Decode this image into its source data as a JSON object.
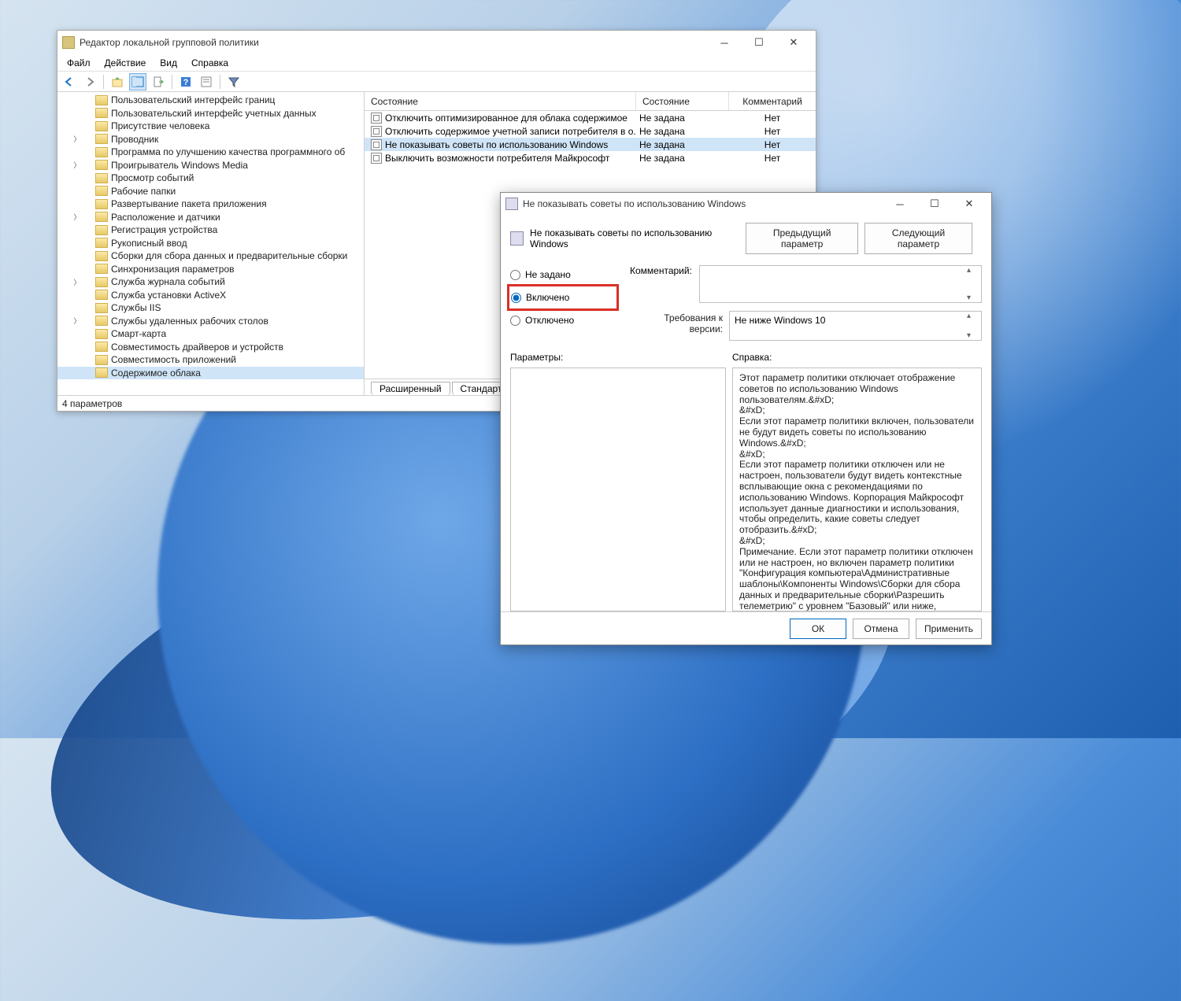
{
  "mainWindow": {
    "title": "Редактор локальной групповой политики",
    "menus": {
      "file": "Файл",
      "action": "Действие",
      "view": "Вид",
      "help": "Справка"
    },
    "tree": [
      {
        "label": "Пользовательский интерфейс границ",
        "exp": false
      },
      {
        "label": "Пользовательский интерфейс учетных данных",
        "exp": false
      },
      {
        "label": "Присутствие человека",
        "exp": false
      },
      {
        "label": "Проводник",
        "exp": true
      },
      {
        "label": "Программа по улучшению качества программного об",
        "exp": false
      },
      {
        "label": "Проигрыватель Windows Media",
        "exp": true
      },
      {
        "label": "Просмотр событий",
        "exp": false
      },
      {
        "label": "Рабочие папки",
        "exp": false
      },
      {
        "label": "Развертывание пакета приложения",
        "exp": false
      },
      {
        "label": "Расположение и датчики",
        "exp": true
      },
      {
        "label": "Регистрация устройства",
        "exp": false
      },
      {
        "label": "Рукописный ввод",
        "exp": false
      },
      {
        "label": "Сборки для сбора данных и предварительные сборки",
        "exp": false
      },
      {
        "label": "Синхронизация параметров",
        "exp": false
      },
      {
        "label": "Служба журнала событий",
        "exp": true
      },
      {
        "label": "Служба установки ActiveX",
        "exp": false
      },
      {
        "label": "Службы IIS",
        "exp": false
      },
      {
        "label": "Службы удаленных рабочих столов",
        "exp": true
      },
      {
        "label": "Смарт-карта",
        "exp": false
      },
      {
        "label": "Совместимость драйверов и устройств",
        "exp": false
      },
      {
        "label": "Совместимость приложений",
        "exp": false
      },
      {
        "label": "Содержимое облака",
        "exp": false,
        "sel": true
      }
    ],
    "columns": {
      "c1": "Состояние",
      "c2": "Состояние",
      "c3": "Комментарий"
    },
    "items": [
      {
        "name": "Отключить оптимизированное для облака содержимое",
        "state": "Не задана",
        "comment": "Нет"
      },
      {
        "name": "Отключить содержимое учетной записи потребителя в о...",
        "state": "Не задана",
        "comment": "Нет"
      },
      {
        "name": "Не показывать советы по использованию Windows",
        "state": "Не задана",
        "comment": "Нет",
        "sel": true
      },
      {
        "name": "Выключить возможности потребителя Майкрософт",
        "state": "Не задана",
        "comment": "Нет"
      }
    ],
    "tabs": {
      "extended": "Расширенный",
      "standard": "Стандартный"
    },
    "status": "4 параметров"
  },
  "dialog": {
    "title": "Не показывать советы по использованию Windows",
    "header": "Не показывать советы по использованию Windows",
    "prevBtn": "Предыдущий параметр",
    "nextBtn": "Следующий параметр",
    "radios": {
      "notConfigured": "Не задано",
      "enabled": "Включено",
      "disabled": "Отключено"
    },
    "selectedRadio": "enabled",
    "commentLabel": "Комментарий:",
    "requirementLabel": "Требования к версии:",
    "requirementValue": "Не ниже Windows 10",
    "paramsLabel": "Параметры:",
    "helpLabel": "Справка:",
    "helpText": "Этот параметр политики отключает отображение советов по использованию Windows пользователям.&#xD;\n&#xD;\nЕсли этот параметр политики включен, пользователи не будут видеть советы по использованию Windows.&#xD;\n&#xD;\nЕсли этот параметр политики отключен или не настроен, пользователи будут видеть контекстные всплывающие окна с рекомендациями по использованию Windows. Корпорация Майкрософт использует данные диагностики и использования, чтобы определить, какие советы следует отобразить.&#xD;\n&#xD;\nПримечание. Если этот параметр политики отключен или не настроен, но включен параметр политики \"Конфигурация компьютера\\Административные шаблоны\\Компоненты Windows\\Сборки для сбора данных и предварительные сборки\\Разрешить телеметрию\" с уровнем \"Базовый\" или ниже, пользователи могут видеть ограниченный набор советов.&#xD;\nТакже этот параметр применяется только к SKU",
    "buttons": {
      "ok": "ОК",
      "cancel": "Отмена",
      "apply": "Применить"
    }
  }
}
